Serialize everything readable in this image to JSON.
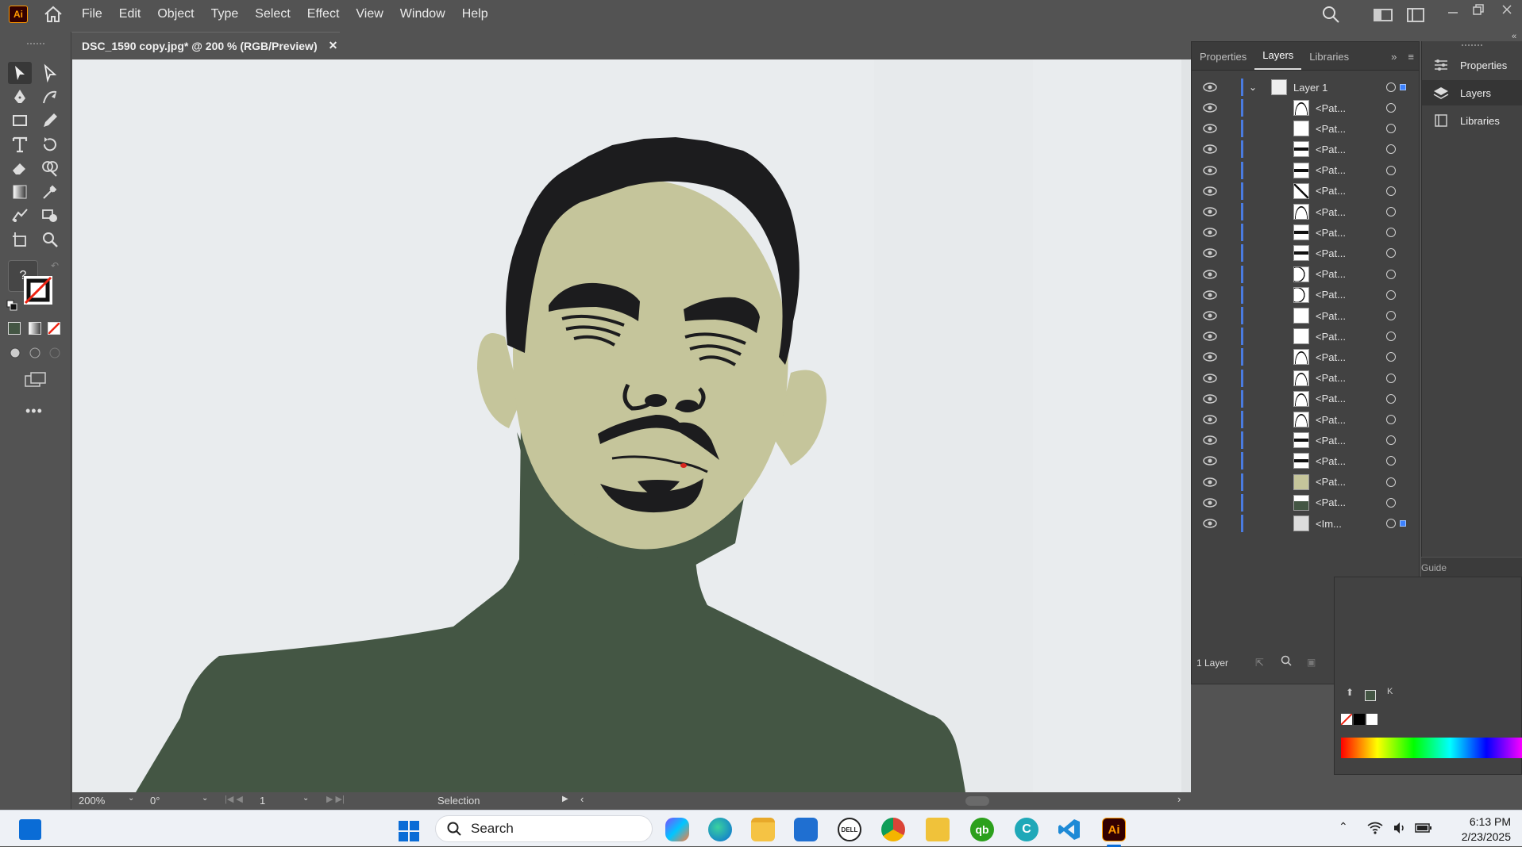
{
  "app": {
    "logo_text": "Ai",
    "logo_color": "#ff9a00"
  },
  "menu": {
    "items": [
      "File",
      "Edit",
      "Object",
      "Type",
      "Select",
      "Effect",
      "View",
      "Window",
      "Help"
    ]
  },
  "document_tab": {
    "title": "DSC_1590 copy.jpg* @ 200 % (RGB/Preview)",
    "close": "✕"
  },
  "status": {
    "zoom": "200%",
    "rotation": "0°",
    "artboard": "1",
    "tool": "Selection"
  },
  "layers_panel": {
    "tabs": [
      "Properties",
      "Layers",
      "Libraries"
    ],
    "active_tab": "Layers",
    "layer_name": "Layer 1",
    "items": [
      "<Pat...",
      "<Pat...",
      "<Pat...",
      "<Pat...",
      "<Pat...",
      "<Pat...",
      "<Pat...",
      "<Pat...",
      "<Pat...",
      "<Pat...",
      "<Pat...",
      "<Pat...",
      "<Pat...",
      "<Pat...",
      "<Pat...",
      "<Pat...",
      "<Pat...",
      "<Pat...",
      "<Pat...",
      "<Pat...",
      "<Im..."
    ],
    "footer_count": "1 Layer"
  },
  "right_dock": {
    "items": [
      "Properties",
      "Layers",
      "Libraries"
    ],
    "partial_label": "Guide",
    "k_label": "K"
  },
  "taskbar": {
    "search_placeholder": "Search",
    "time": "6:13 PM",
    "date": "2/23/2025"
  },
  "colors": {
    "skin": "#c5c59b",
    "shirt": "#445644",
    "hair": "#1c1c1e",
    "canvas_bg": "#e9ecee",
    "accent_blue": "#3d82ff"
  }
}
